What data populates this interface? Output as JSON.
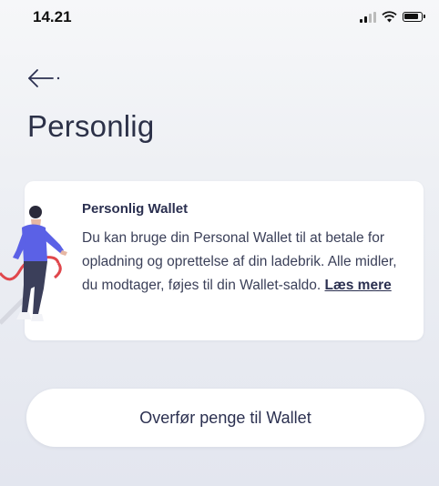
{
  "status_bar": {
    "time": "14.21",
    "icons": [
      "signal-icon",
      "wifi-icon",
      "battery-icon"
    ]
  },
  "header": {
    "back_icon": "arrow-left-icon",
    "title": "Personlig"
  },
  "info_card": {
    "title": "Personlig Wallet",
    "body": "Du kan bruge din Personal Wallet til at betale for opladning og oprettelse af din ladebrik. Alle midler, du modtager, føjes til din Wallet-saldo.",
    "link": "Læs mere",
    "illustration": "person-with-charging-cable-illustration"
  },
  "actions": {
    "transfer_label": "Overfør penge til Wallet"
  },
  "colors": {
    "text_dark": "#2b3050",
    "card_bg": "#ffffff",
    "figure_shirt": "#5b61e6",
    "figure_pants": "#3b3f5a",
    "cable": "#e0474c"
  }
}
